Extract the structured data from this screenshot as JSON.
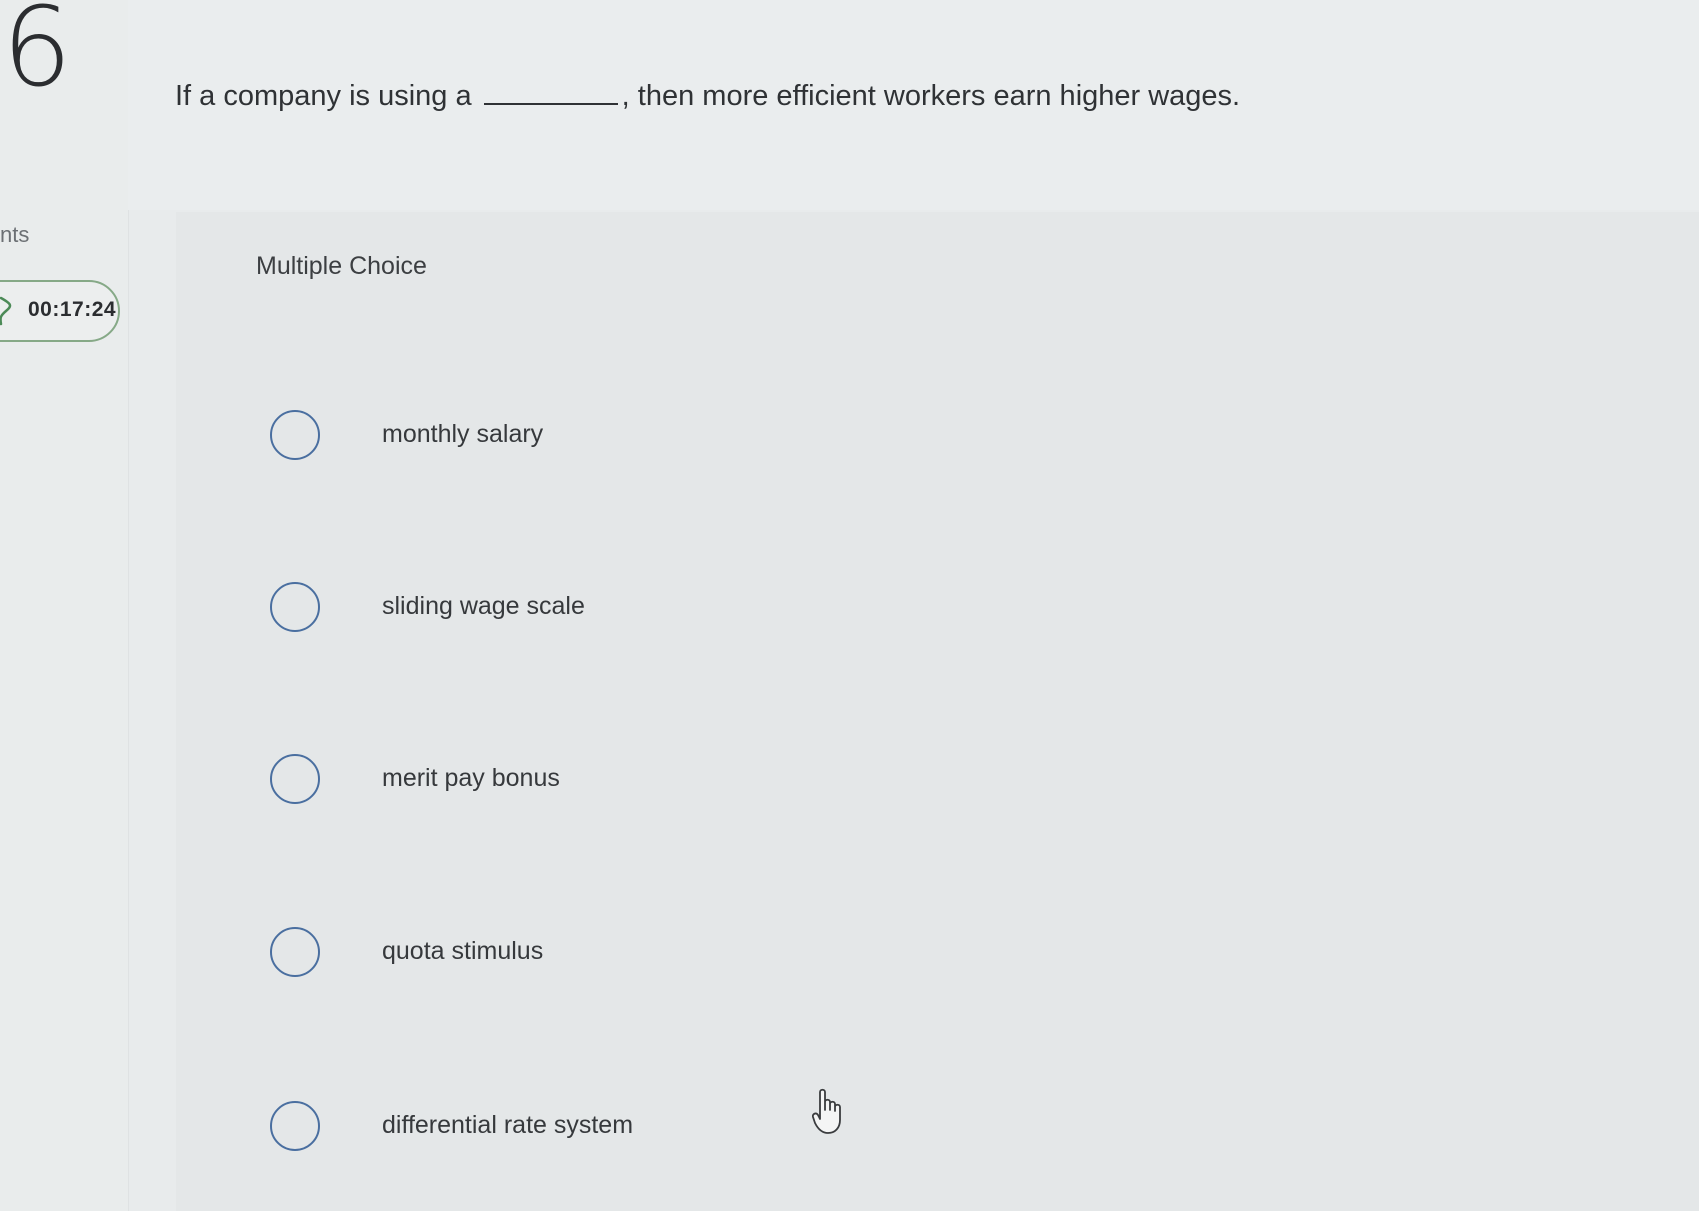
{
  "sidebar": {
    "question_number": "6",
    "points_label": "nts",
    "timer": "00:17:24"
  },
  "question": {
    "prompt_before": "If a company is using a",
    "prompt_after": ", then more efficient workers earn higher wages."
  },
  "answers": {
    "type_label": "Multiple Choice",
    "options": [
      {
        "label": "monthly salary"
      },
      {
        "label": "sliding wage scale"
      },
      {
        "label": "merit pay bonus"
      },
      {
        "label": "quota stimulus"
      },
      {
        "label": "differential rate system"
      }
    ]
  },
  "colors": {
    "radio_border": "#4a6fa0",
    "timer_border": "#86a987",
    "background": "#e8ebec"
  },
  "icons": {
    "timer": "hourglass-icon",
    "cursor": "hand-pointer-icon"
  }
}
